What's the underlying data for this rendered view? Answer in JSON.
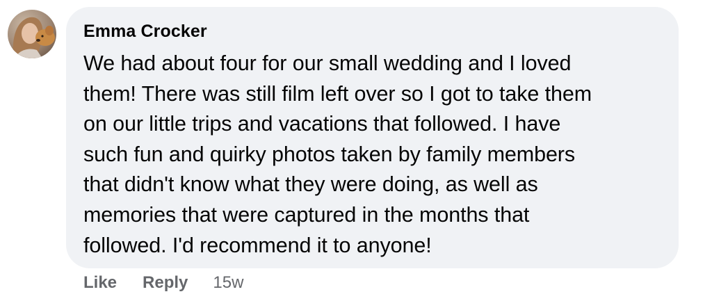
{
  "comment": {
    "author": "Emma Crocker",
    "avatar_icon": "user-avatar-photo",
    "text_lines": [
      "We had about four for our small wedding and I loved",
      "them! There was still film left over so I got to take them",
      "on our little trips and vacations that followed. I have",
      "such fun and quirky photos taken by family members",
      "that didn't know what they were doing, as well as",
      "memories that were captured in the months that",
      "followed. I'd recommend it to anyone!"
    ],
    "actions": {
      "like_label": "Like",
      "reply_label": "Reply",
      "timestamp": "15w"
    }
  },
  "colors": {
    "bubble_background": "#f0f2f5",
    "text": "#050505",
    "secondary_text": "#65676b"
  }
}
